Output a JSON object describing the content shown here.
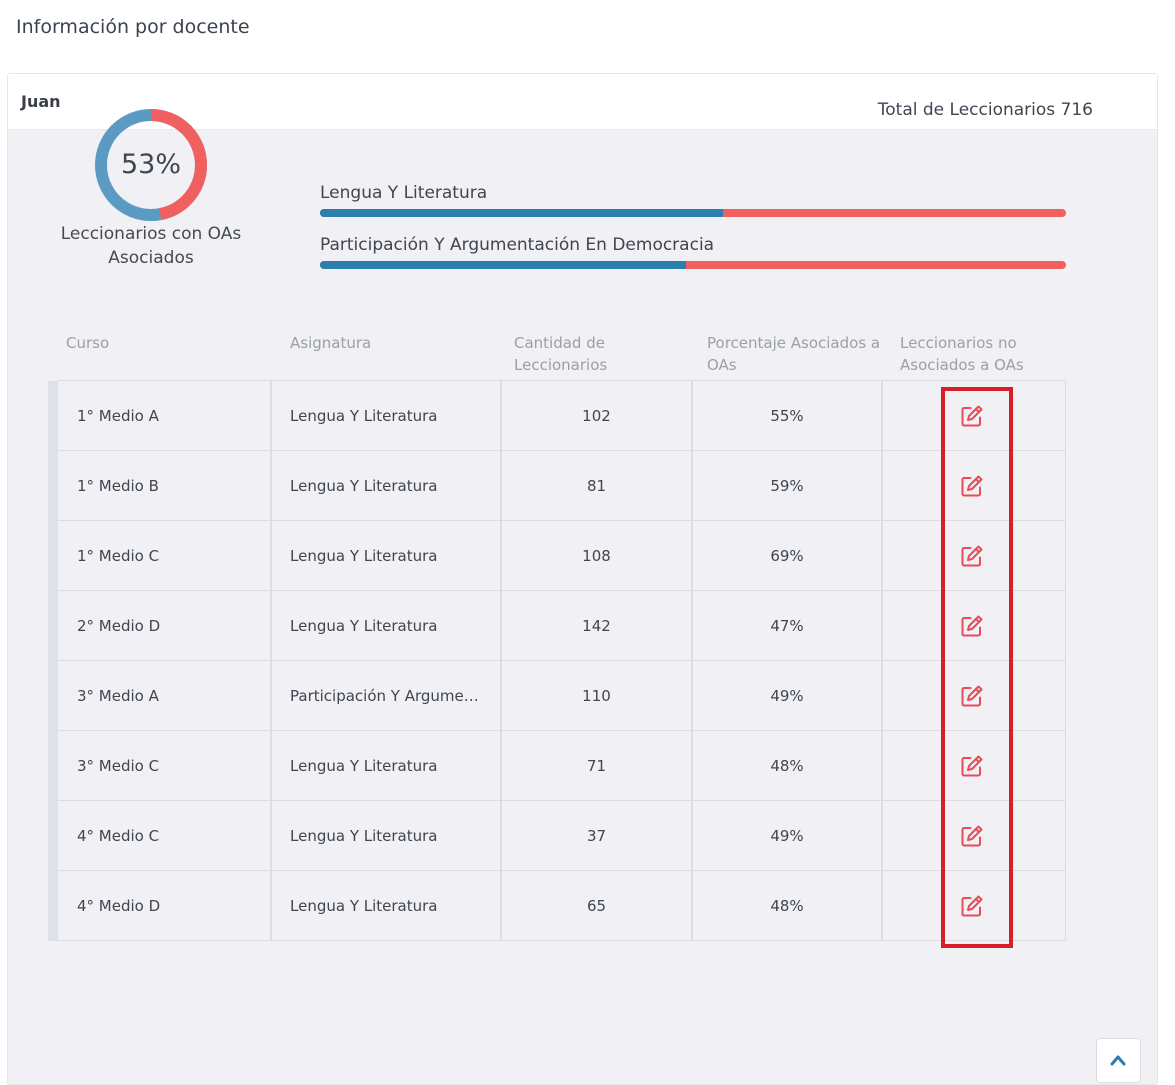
{
  "page": {
    "title": "Información por docente"
  },
  "teacher": {
    "name": "Juan"
  },
  "summary": {
    "donut_percent": 53,
    "donut_text": "53%",
    "donut_label": "Leccionarios con OAs Asociados",
    "total_label": "Total de Leccionarios 716",
    "colors": {
      "primary": "#5b9bc3",
      "secondary": "#f06060"
    },
    "subjects": [
      {
        "name": "Lengua Y Literatura",
        "fraction": 0.54
      },
      {
        "name": "Participación Y Argumentación En Democracia",
        "fraction": 0.49
      }
    ]
  },
  "table": {
    "headers": {
      "curso": "Curso",
      "asignatura": "Asignatura",
      "cantidad": "Cantidad de Leccionarios",
      "porcentaje": "Porcentaje Asociados a OAs",
      "no_asociados": "Leccionarios no Asociados a OAs"
    },
    "rows": [
      {
        "curso": "1° Medio A",
        "asignatura": "Lengua Y Literatura",
        "cantidad": "102",
        "porcentaje": "55%",
        "icon": "edit-icon"
      },
      {
        "curso": "1° Medio B",
        "asignatura": "Lengua Y Literatura",
        "cantidad": "81",
        "porcentaje": "59%",
        "icon": "edit-icon"
      },
      {
        "curso": "1° Medio C",
        "asignatura": "Lengua Y Literatura",
        "cantidad": "108",
        "porcentaje": "69%",
        "icon": "edit-icon"
      },
      {
        "curso": "2° Medio D",
        "asignatura": "Lengua Y Literatura",
        "cantidad": "142",
        "porcentaje": "47%",
        "icon": "edit-icon"
      },
      {
        "curso": "3° Medio A",
        "asignatura": "Participación Y Argument...",
        "cantidad": "110",
        "porcentaje": "49%",
        "icon": "edit-icon"
      },
      {
        "curso": "3° Medio C",
        "asignatura": "Lengua Y Literatura",
        "cantidad": "71",
        "porcentaje": "48%",
        "icon": "edit-icon"
      },
      {
        "curso": "4° Medio C",
        "asignatura": "Lengua Y Literatura",
        "cantidad": "37",
        "porcentaje": "49%",
        "icon": "edit-icon"
      },
      {
        "curso": "4° Medio D",
        "asignatura": "Lengua Y Literatura",
        "cantidad": "65",
        "porcentaje": "48%",
        "icon": "edit-icon"
      }
    ]
  },
  "highlight_color": "#d61f26",
  "scroll_top_icon": "chevron-up-icon"
}
